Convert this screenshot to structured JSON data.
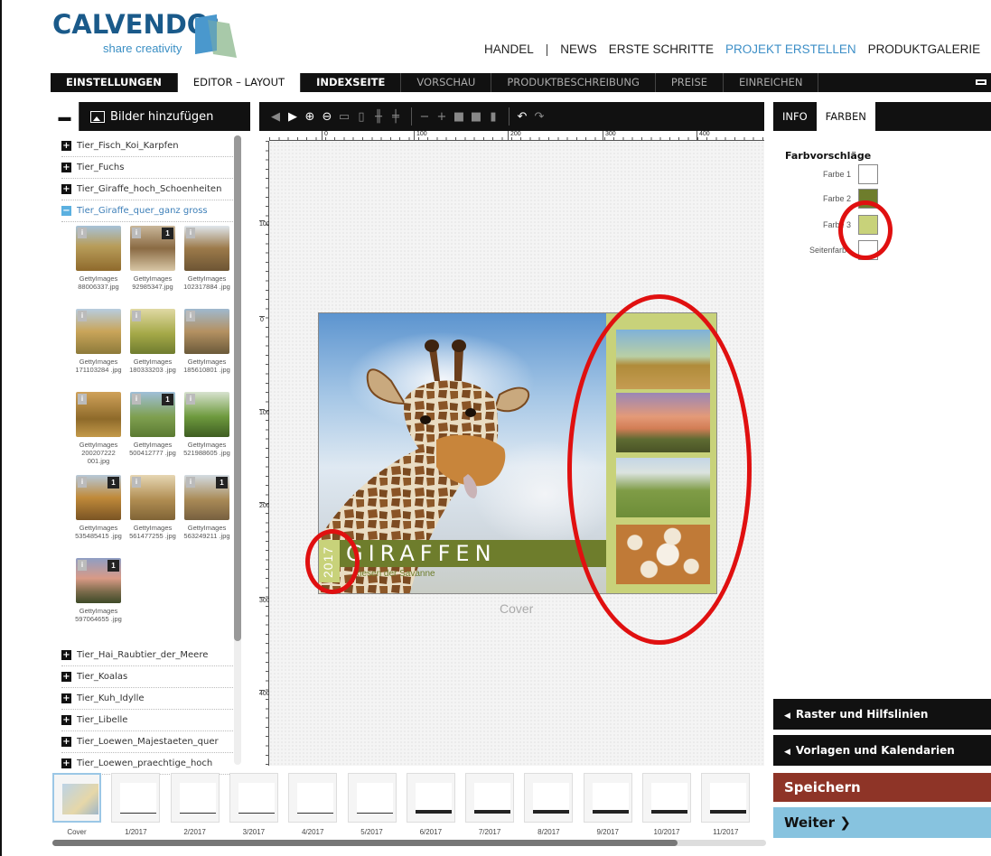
{
  "brand": {
    "name": "CALVENDO",
    "reg": "®",
    "tagline": "share creativity"
  },
  "topnav": {
    "handel": "HANDEL",
    "sep": "|",
    "news": "NEWS",
    "erste": "ERSTE SCHRITTE",
    "projekt": "PROJEKT ERSTELLEN",
    "galerie": "PRODUKTGALERIE"
  },
  "tabs": [
    "EINSTELLUNGEN",
    "EDITOR – LAYOUT",
    "INDEXSEITE",
    "VORSCHAU",
    "PRODUKTBESCHREIBUNG",
    "PREISE",
    "EINREICHEN"
  ],
  "left_panel": {
    "add_images": "Bilder hinzufügen",
    "folders_top": [
      "Tier_Fisch_Koi_Karpfen",
      "Tier_Fuchs",
      "Tier_Giraffe_hoch_Schoenheiten"
    ],
    "open_folder": "Tier_Giraffe_quer_ganz gross",
    "images": [
      {
        "name": "GettyImages 88006337.jpg",
        "badge": ""
      },
      {
        "name": "GettyImages 92985347.jpg",
        "badge": "1"
      },
      {
        "name": "GettyImages 102317884 .jpg",
        "badge": ""
      },
      {
        "name": "GettyImages 171103284 .jpg",
        "badge": ""
      },
      {
        "name": "GettyImages 180333203 .jpg",
        "badge": ""
      },
      {
        "name": "GettyImages 185610801 .jpg",
        "badge": ""
      },
      {
        "name": "GettyImages 200207222 001.jpg",
        "badge": ""
      },
      {
        "name": "GettyImages 500412777 .jpg",
        "badge": "1"
      },
      {
        "name": "GettyImages 521988605 .jpg",
        "badge": ""
      },
      {
        "name": "GettyImages 535485415 .jpg",
        "badge": "1"
      },
      {
        "name": "GettyImages 561477255 .jpg",
        "badge": ""
      },
      {
        "name": "GettyImages 563249211 .jpg",
        "badge": "1"
      },
      {
        "name": "GettyImages 597064655 .jpg",
        "badge": "1"
      }
    ],
    "folders_bottom": [
      "Tier_Hai_Raubtier_der_Meere",
      "Tier_Koalas",
      "Tier_Kuh_Idylle",
      "Tier_Libelle",
      "Tier_Loewen_Majestaeten_quer",
      "Tier_Loewen_praechtige_hoch"
    ]
  },
  "ruler": {
    "h_labels": [
      "0",
      "100",
      "200",
      "300",
      "400"
    ],
    "v_labels": [
      "100",
      "0",
      "100",
      "200",
      "300",
      "400"
    ]
  },
  "cover": {
    "year": "2017",
    "title": "GIRAFFEN",
    "subtitle": "Riesen der Savanne",
    "label": "Cover"
  },
  "right_panel": {
    "tab_info": "INFO",
    "tab_farben": "FARBEN",
    "heading": "Farbvorschläge",
    "colors": [
      {
        "label": "Farbe 1",
        "hex": "#ffffff"
      },
      {
        "label": "Farbe 2",
        "hex": "#6e7d2c"
      },
      {
        "label": "Farbe 3",
        "hex": "#c8d27a"
      },
      {
        "label": "Seitenfarbe",
        "hex": "#ffffff"
      }
    ],
    "raster": "Raster und Hilfslinien",
    "vorlagen": "Vorlagen und Kalendarien",
    "save": "Speichern",
    "next": "Weiter"
  },
  "filmstrip": [
    "Cover",
    "1/2017",
    "2/2017",
    "3/2017",
    "4/2017",
    "5/2017",
    "6/2017",
    "7/2017",
    "8/2017",
    "9/2017",
    "10/2017",
    "11/2017"
  ]
}
